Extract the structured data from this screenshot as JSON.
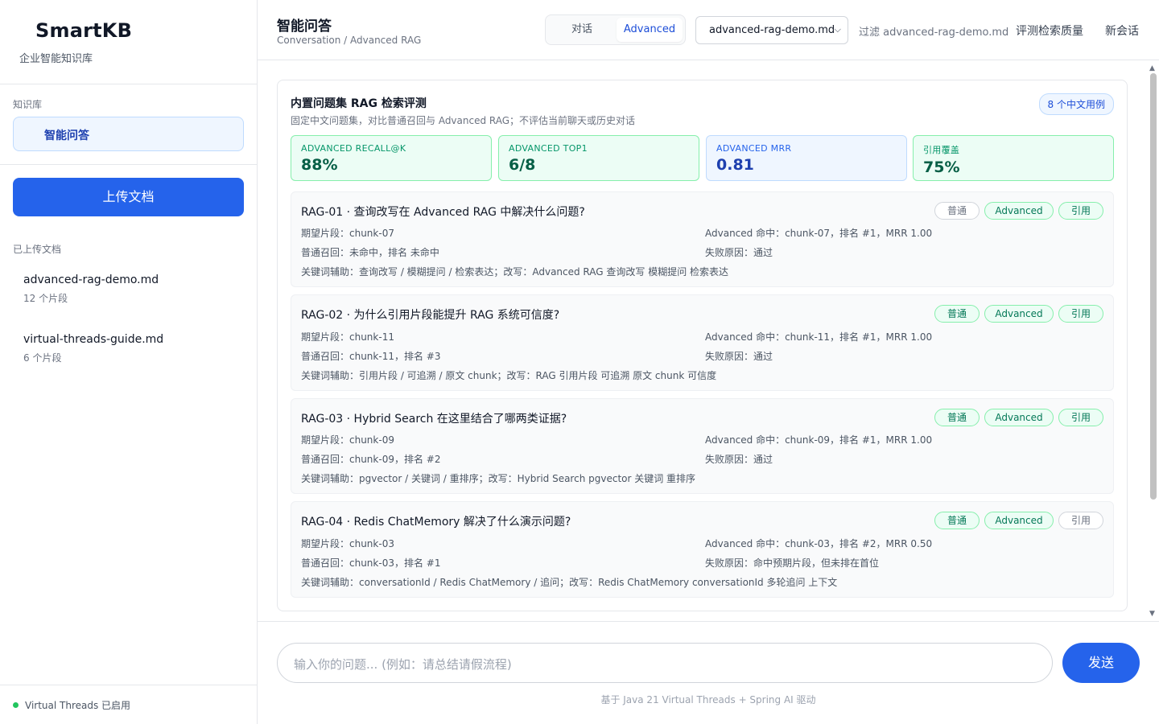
{
  "brand": {
    "title": "SmartKB",
    "subtitle": "企业智能知识库"
  },
  "sidebar": {
    "kb_label": "知识库",
    "kb_item": "智能问答",
    "upload_label": "上传文档",
    "docs_label": "已上传文档",
    "documents": [
      {
        "name": "advanced-rag-demo.md",
        "meta": "12 个片段"
      },
      {
        "name": "virtual-threads-guide.md",
        "meta": "6 个片段"
      }
    ],
    "status": "Virtual Threads 已启用",
    "status_color": "#22c55e"
  },
  "header": {
    "title": "智能问答",
    "breadcrumb": "Conversation / Advanced RAG",
    "mode_tabs": [
      "对话",
      "Advanced"
    ],
    "active_mode": "Advanced",
    "doc_select": "advanced-rag-demo.md",
    "filter_text": "过滤 advanced-rag-demo.md",
    "evaluate_link": "评测检索质量",
    "new_session_link": "新会话"
  },
  "eval": {
    "title": "内置问题集 RAG 检索评测",
    "subtitle": "固定中文问题集，对比普通召回与 Advanced RAG；不评估当前聊天或历史对话",
    "count_badge": "8 个中文用例",
    "metrics": [
      {
        "label": "ADVANCED RECALL@K",
        "value": "88%"
      },
      {
        "label": "ADVANCED TOP1",
        "value": "6/8"
      },
      {
        "label": "ADVANCED MRR",
        "value": "0.81"
      },
      {
        "label": "引用覆盖",
        "value": "75%"
      }
    ],
    "tag_labels": [
      "普通",
      "Advanced",
      "引用"
    ],
    "cases": [
      {
        "title": "RAG-01 · 查询改写在 Advanced RAG 中解决什么问题?",
        "tags_on": [
          false,
          true,
          true
        ],
        "expected": "期望片段：chunk-07",
        "baseline": "普通召回：未命中，排名 未命中",
        "advanced": "Advanced 命中：chunk-07，排名 #1，MRR 1.00",
        "failure": "失败原因：通过",
        "keywords": "关键词辅助：查询改写 / 模糊提问 / 检索表达；改写：Advanced RAG 查询改写 模糊提问 检索表达"
      },
      {
        "title": "RAG-02 · 为什么引用片段能提升 RAG 系统可信度?",
        "tags_on": [
          true,
          true,
          true
        ],
        "expected": "期望片段：chunk-11",
        "baseline": "普通召回：chunk-11，排名 #3",
        "advanced": "Advanced 命中：chunk-11，排名 #1，MRR 1.00",
        "failure": "失败原因：通过",
        "keywords": "关键词辅助：引用片段 / 可追溯 / 原文 chunk；改写：RAG 引用片段 可追溯 原文 chunk 可信度"
      },
      {
        "title": "RAG-03 · Hybrid Search 在这里结合了哪两类证据?",
        "tags_on": [
          true,
          true,
          true
        ],
        "expected": "期望片段：chunk-09",
        "baseline": "普通召回：chunk-09，排名 #2",
        "advanced": "Advanced 命中：chunk-09，排名 #1，MRR 1.00",
        "failure": "失败原因：通过",
        "keywords": "关键词辅助：pgvector / 关键词 / 重排序；改写：Hybrid Search pgvector 关键词 重排序"
      },
      {
        "title": "RAG-04 · Redis ChatMemory 解决了什么演示问题?",
        "tags_on": [
          true,
          true,
          false
        ],
        "expected": "期望片段：chunk-03",
        "baseline": "普通召回：chunk-03，排名 #1",
        "advanced": "Advanced 命中：chunk-03，排名 #2，MRR 0.50",
        "failure": "失败原因：命中预期片段，但未排在首位",
        "keywords": "关键词辅助：conversationId / Redis ChatMemory / 追问；改写：Redis ChatMemory conversationId 多轮追问 上下文"
      }
    ]
  },
  "composer": {
    "placeholder": "输入你的问题... (例如：请总结请假流程)",
    "send_label": "发送",
    "footer": "基于 Java 21 Virtual Threads + Spring AI 驱动"
  },
  "colors": {
    "accent": "#2563eb",
    "success": "#047857"
  }
}
